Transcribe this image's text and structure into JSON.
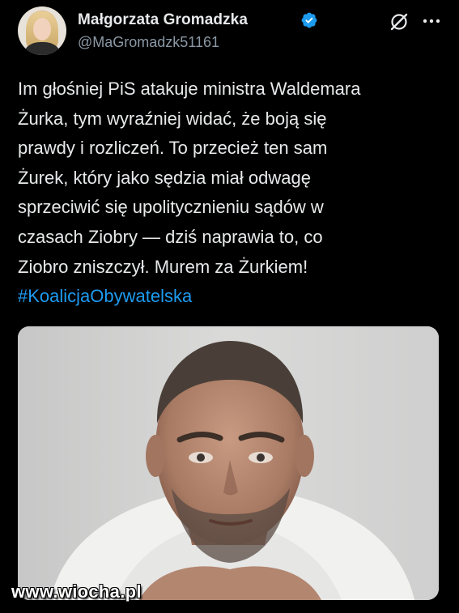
{
  "author": {
    "display_name": "Małgorzata Gromadzka",
    "handle": "@MaGromadzk51161",
    "verified": true,
    "avatar_icon": "user-avatar-photo"
  },
  "header_actions": {
    "grok_icon": "grok-icon",
    "more_icon": "more-options-icon"
  },
  "tweet": {
    "lines": [
      "Im głośniej PiS atakuje ministra Waldemara",
      "Żurka, tym wyraźniej widać, że boją się",
      "prawdy i rozliczeń. To przecież ten sam",
      "Żurek, który jako sędzia miał odwagę",
      "sprzeciwić się upolitycznieniu sądów w",
      "czasach Ziobry — dziś naprawia to, co",
      "Ziobro zniszczył. Murem za Żurkiem!"
    ],
    "hashtag": "#KoalicjaObywatelska",
    "media_alt": "portrait-photo"
  },
  "watermark": "www.wiocha.pl",
  "colors": {
    "background": "#000000",
    "text": "#e7e9ea",
    "secondary": "#8b98a5",
    "accent": "#1d9bf0"
  }
}
